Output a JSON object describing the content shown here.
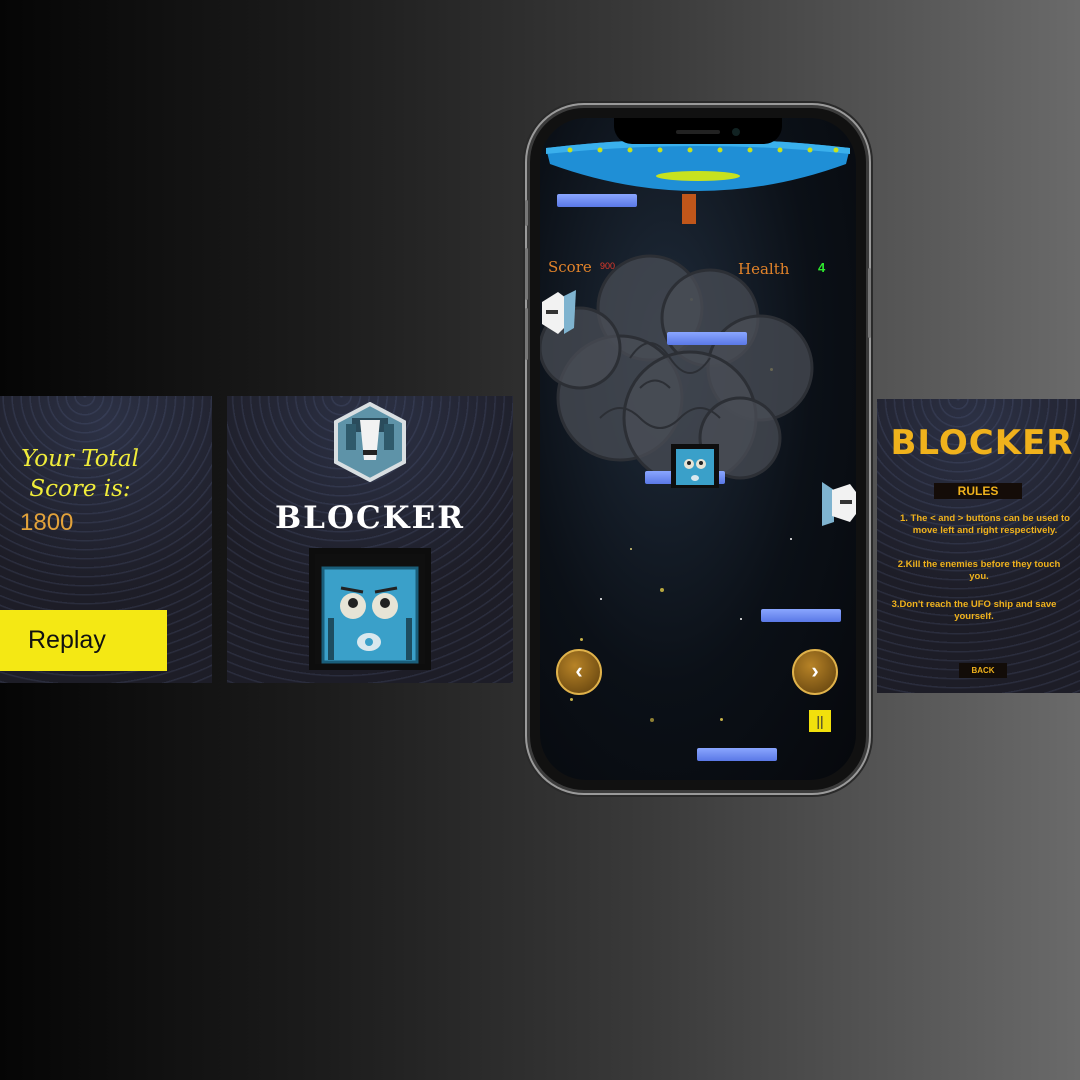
{
  "score_screen": {
    "title": "Your Total Score is:",
    "score": "1800",
    "replay_label": "Replay"
  },
  "title_screen": {
    "game_title": "BLOCKER"
  },
  "game_screen": {
    "score_label": "Score",
    "score_value": "900",
    "health_label": "Health",
    "health_value": "4",
    "left_icon": "chevron-left-icon",
    "right_icon": "chevron-right-icon",
    "pause_icon": "pause-icon",
    "left_glyph": "‹",
    "right_glyph": "›",
    "pause_glyph": "||"
  },
  "rules_screen": {
    "title": "BLOCKER",
    "heading": "RULES",
    "rules": [
      "1. The < and > buttons can be used to move left and right respectively.",
      "2.Kill the enemies before they touch you.",
      "3.Don't reach the UFO ship and save yourself."
    ],
    "back_label": "BACK"
  },
  "colors": {
    "accent_yellow": "#f4e814",
    "gold": "#f0b21c",
    "score_orange": "#e2a23a",
    "health_green": "#2ee82e",
    "platform_blue": "#6f8cff"
  }
}
